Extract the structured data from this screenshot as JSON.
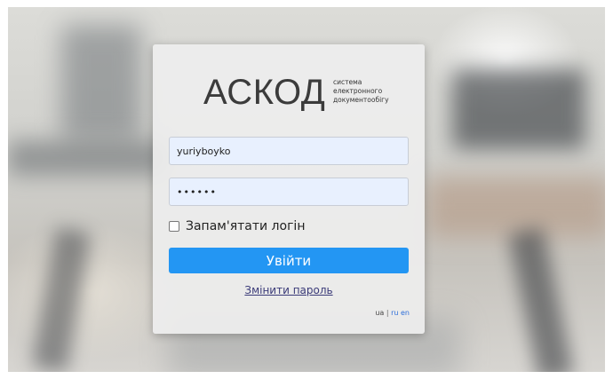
{
  "brand": {
    "name": "АСКОД",
    "subtitle_lines": [
      "система",
      "електронного",
      "документообігу"
    ]
  },
  "form": {
    "login_value": "yuriyboyko",
    "password_value": "••••••",
    "remember_label": "Запам'ятати логін",
    "remember_checked": false,
    "submit_label": "Увійти",
    "change_password_label": "Змінити пароль"
  },
  "languages": {
    "ua": "ua",
    "separator": "|",
    "ru": "ru",
    "en": "en"
  },
  "colors": {
    "button": "#2396f3",
    "field_bg": "#e8f0fe",
    "link": "#3a3a78",
    "lang_link": "#2d6ed9"
  }
}
